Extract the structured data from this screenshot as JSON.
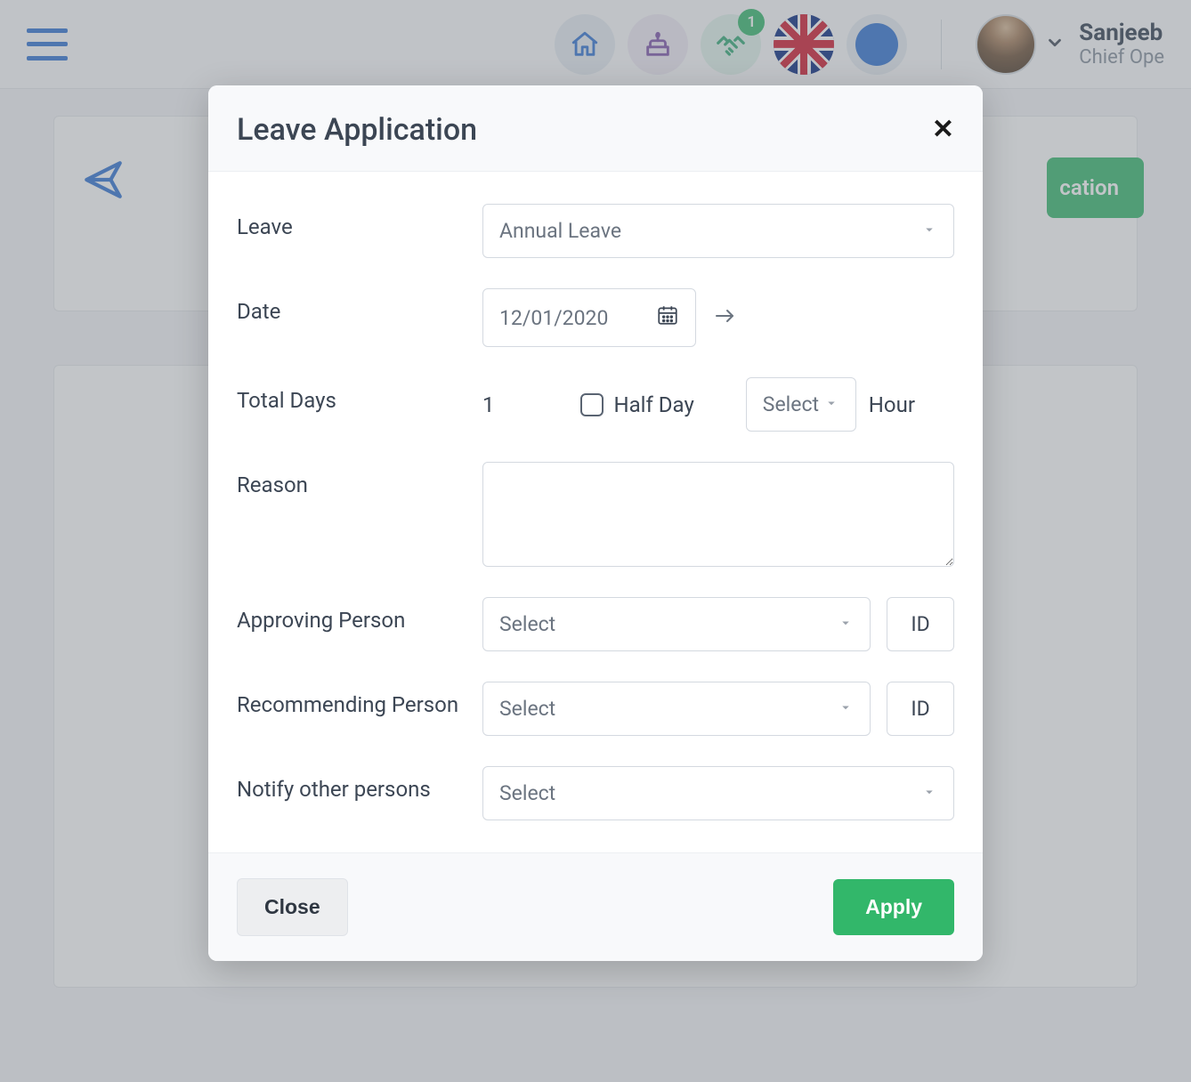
{
  "header": {
    "badge_count": "1",
    "user_name": "Sanjeeb",
    "user_role": "Chief Ope"
  },
  "background": {
    "green_button_partial": "cation"
  },
  "modal": {
    "title": "Leave Application",
    "labels": {
      "leave": "Leave",
      "date": "Date",
      "total_days": "Total Days",
      "reason": "Reason",
      "approving": "Approving Person",
      "recommending": "Recommending Person",
      "notify": "Notify other persons"
    },
    "fields": {
      "leave_value": "Annual Leave",
      "date_value": "12/01/2020",
      "total_days_value": "1",
      "half_day_label": "Half Day",
      "hour_select_value": "Select",
      "hour_label": "Hour",
      "approving_value": "Select",
      "approving_id": "ID",
      "recommending_value": "Select",
      "recommending_id": "ID",
      "notify_value": "Select"
    },
    "footer": {
      "close": "Close",
      "apply": "Apply"
    }
  }
}
